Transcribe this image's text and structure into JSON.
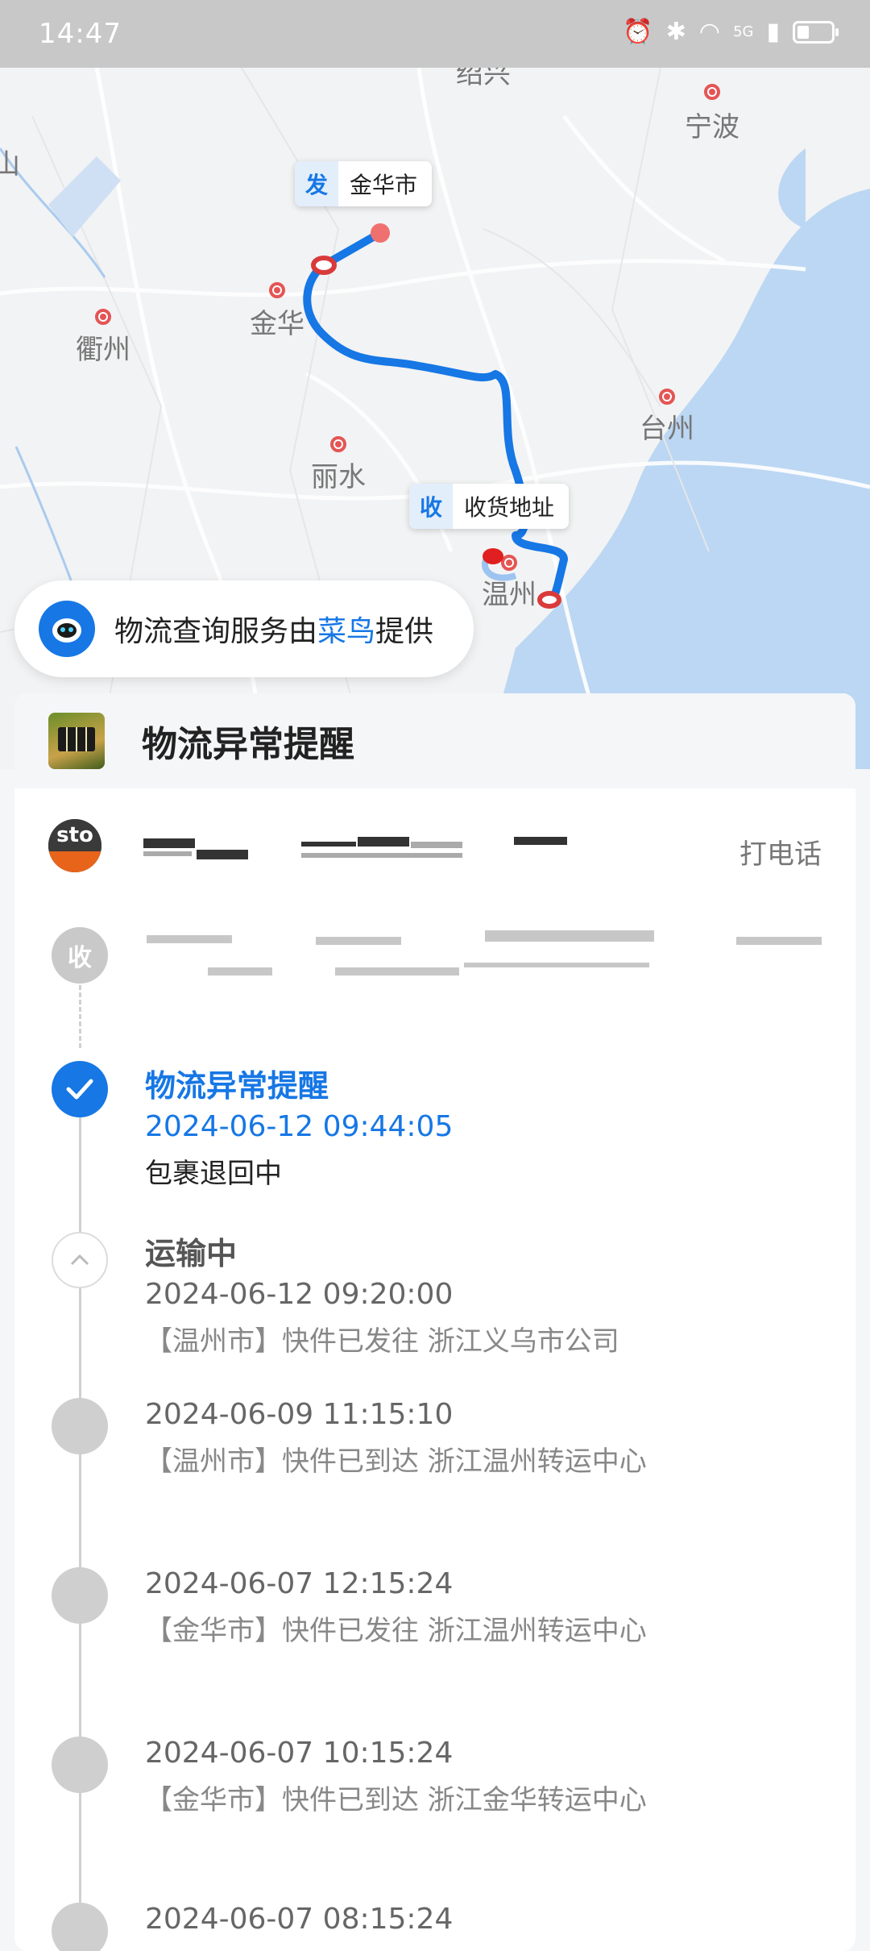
{
  "status_bar": {
    "time": "14:47",
    "network": "5G"
  },
  "map": {
    "cities": [
      "绍兴",
      "宁波",
      "金华",
      "衢州",
      "丽水",
      "台州",
      "温州",
      "山"
    ],
    "send_tag": {
      "badge": "发",
      "label": "金华市"
    },
    "recv_tag": {
      "badge": "收",
      "label": "收货地址"
    },
    "route_color": "#1677e5",
    "sea_color": "#bcd7f3"
  },
  "service": {
    "prefix": "物流查询服务由",
    "brand": "菜鸟",
    "suffix": "提供"
  },
  "card": {
    "title": "物流异常提醒",
    "courier_call": "打电话",
    "receiver_badge": "收"
  },
  "timeline": [
    {
      "title": "物流异常提醒",
      "time": "2024-06-12 09:44:05",
      "desc": "包裹退回中"
    },
    {
      "title": "运输中",
      "time": "2024-06-12 09:20:00",
      "desc": "【温州市】快件已发往 浙江义乌市公司"
    },
    {
      "time": "2024-06-09 11:15:10",
      "desc": "【温州市】快件已到达 浙江温州转运中心"
    },
    {
      "time": "2024-06-07 12:15:24",
      "desc": "【金华市】快件已发往 浙江温州转运中心"
    },
    {
      "time": "2024-06-07 10:15:24",
      "desc": "【金华市】快件已到达 浙江金华转运中心"
    },
    {
      "time": "2024-06-07 08:15:24"
    }
  ]
}
